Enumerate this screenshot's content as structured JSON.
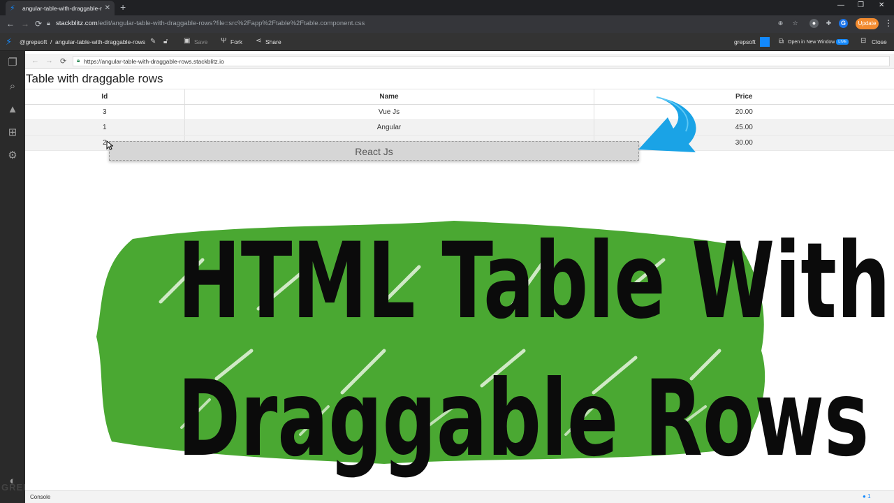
{
  "browser": {
    "tab_title": "angular-table-with-draggable-ro",
    "url_host": "stackblitz.com",
    "url_path": "/edit/angular-table-with-draggable-rows?file=src%2Fapp%2Ftable%2Ftable.component.css",
    "update_label": "Update",
    "profile_initial": "G"
  },
  "stackblitz": {
    "user": "@grepsoft",
    "separator": "/",
    "project": "angular-table-with-draggable-rows",
    "save_label": "Save",
    "fork_label": "Fork",
    "share_label": "Share",
    "account": "grepsoft",
    "open_new_window": "Open in New Window",
    "live_badge": "LIVE",
    "close_label": "Close"
  },
  "preview": {
    "url": "https://angular-table-with-draggable-rows.stackblitz.io",
    "heading": "Table with draggable rows",
    "columns": [
      "Id",
      "Name",
      "Price"
    ],
    "rows": [
      {
        "id": "3",
        "name": "Vue Js",
        "price": "20.00"
      },
      {
        "id": "1",
        "name": "Angular",
        "price": "45.00"
      },
      {
        "id": "2",
        "name": "",
        "price": "30.00"
      }
    ],
    "drag_ghost_label": "React Js"
  },
  "overlay": {
    "line1": "HTML Table With",
    "line2": "Draggable Rows",
    "brush_color": "#4aa832",
    "arrow_color": "#1aa3e6"
  },
  "console": {
    "label": "Console",
    "badge_count": "1"
  },
  "watermark": "GREPSOFT"
}
